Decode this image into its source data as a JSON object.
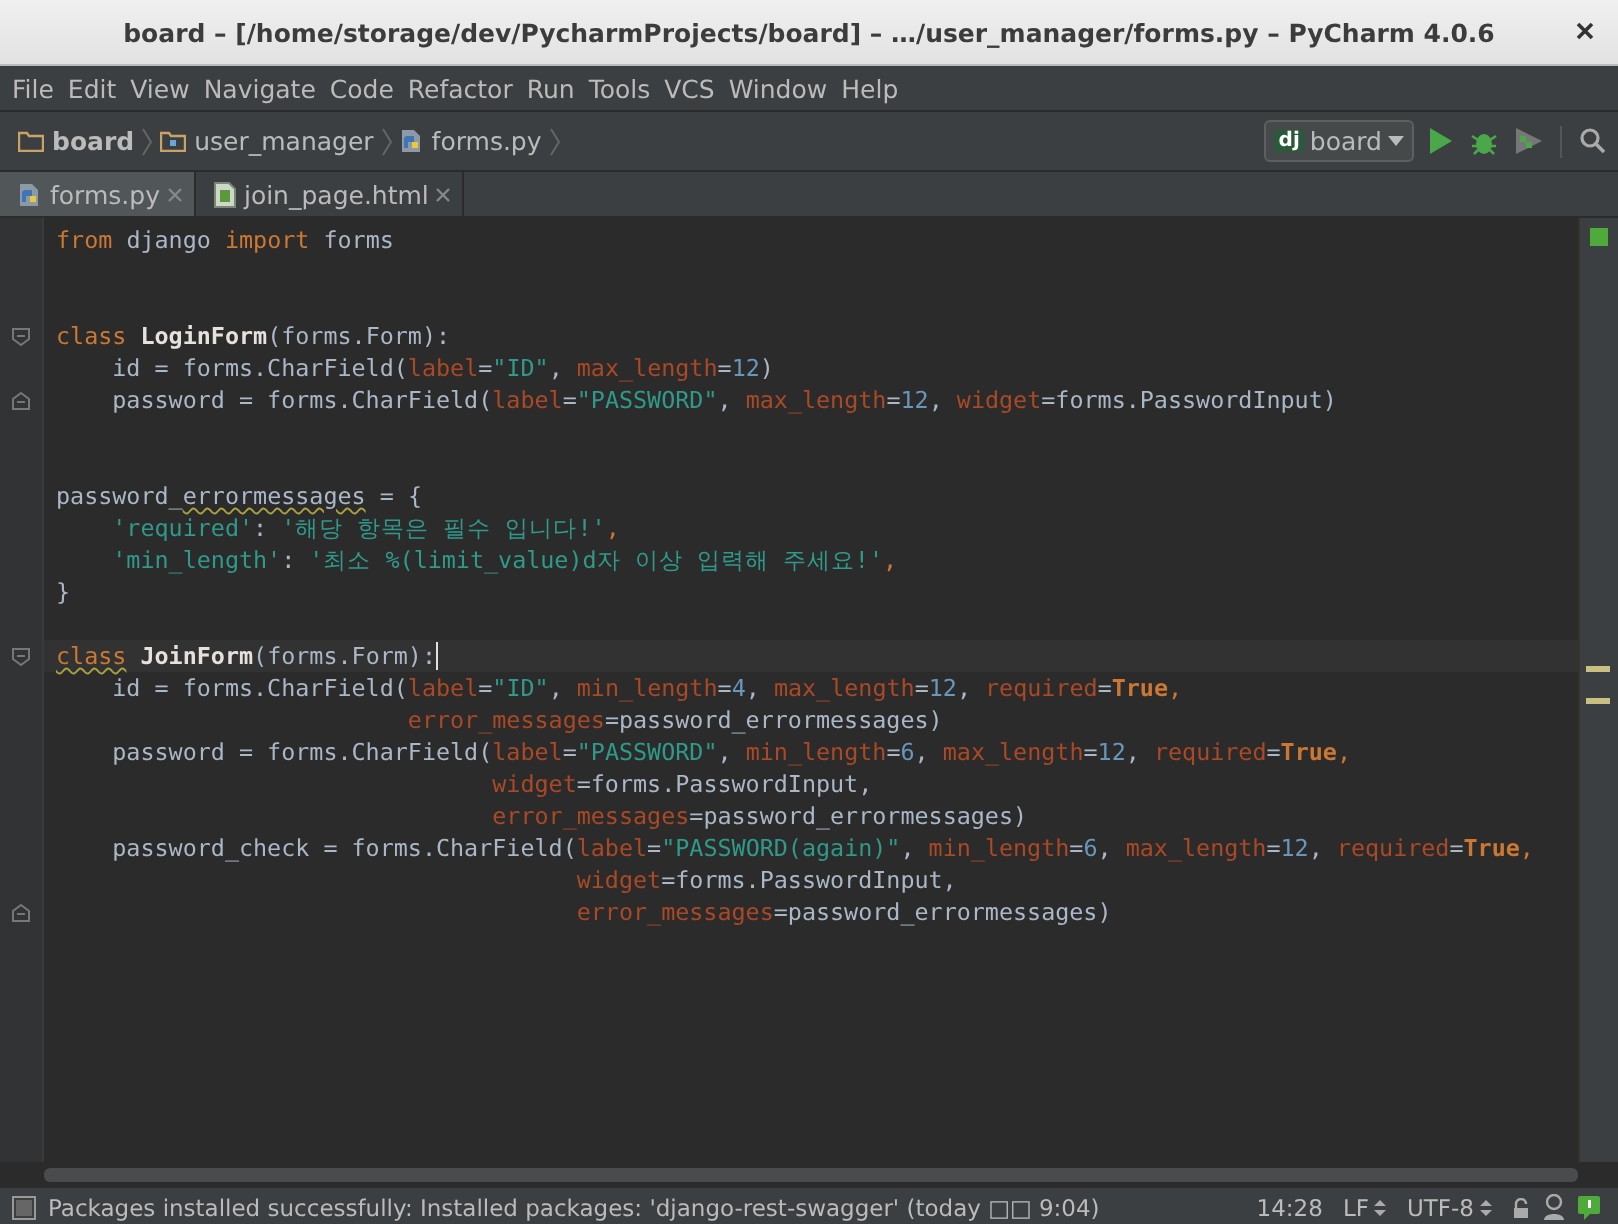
{
  "window": {
    "title": "board – [/home/storage/dev/PycharmProjects/board] – …/user_manager/forms.py – PyCharm 4.0.6"
  },
  "menu": [
    "File",
    "Edit",
    "View",
    "Navigate",
    "Code",
    "Refactor",
    "Run",
    "Tools",
    "VCS",
    "Window",
    "Help"
  ],
  "breadcrumbs": [
    {
      "label": "board",
      "kind": "project"
    },
    {
      "label": "user_manager",
      "kind": "package"
    },
    {
      "label": "forms.py",
      "kind": "python"
    }
  ],
  "run_config": {
    "label": "board",
    "badge": "dj"
  },
  "tabs": [
    {
      "label": "forms.py",
      "kind": "python",
      "selected": true
    },
    {
      "label": "join_page.html",
      "kind": "html",
      "selected": false
    }
  ],
  "lines": [
    {
      "kind": "code",
      "tokens": [
        {
          "kind": "kw",
          "t": "from"
        },
        {
          "kind": "p",
          "t": " django "
        },
        {
          "kind": "kw",
          "t": "import"
        },
        {
          "kind": "p",
          "t": " forms"
        }
      ]
    },
    {
      "kind": "blank"
    },
    {
      "kind": "blank"
    },
    {
      "kind": "code",
      "fold": {
        "kind": "start"
      },
      "tokens": [
        {
          "kind": "kw",
          "t": "class"
        },
        {
          "kind": "cls",
          "t": " LoginForm"
        },
        {
          "kind": "p",
          "t": "(forms.Form):"
        }
      ]
    },
    {
      "kind": "code",
      "tokens": [
        {
          "kind": "p",
          "t": "    id = forms.CharField("
        },
        {
          "kind": "prm",
          "t": "label"
        },
        {
          "kind": "p",
          "t": "="
        },
        {
          "kind": "str",
          "t": "\"ID\""
        },
        {
          "kind": "p",
          "t": ", "
        },
        {
          "kind": "prm",
          "t": "max_length"
        },
        {
          "kind": "p",
          "t": "="
        },
        {
          "kind": "num",
          "t": "12"
        },
        {
          "kind": "p",
          "t": ")"
        }
      ]
    },
    {
      "kind": "code",
      "fold": {
        "kind": "end"
      },
      "tokens": [
        {
          "kind": "p",
          "t": "    password = forms.CharField("
        },
        {
          "kind": "prm",
          "t": "label"
        },
        {
          "kind": "p",
          "t": "="
        },
        {
          "kind": "str",
          "t": "\"PASSWORD\""
        },
        {
          "kind": "p",
          "t": ", "
        },
        {
          "kind": "prm",
          "t": "max_length"
        },
        {
          "kind": "p",
          "t": "="
        },
        {
          "kind": "num",
          "t": "12"
        },
        {
          "kind": "p",
          "t": ", "
        },
        {
          "kind": "prm",
          "t": "widget"
        },
        {
          "kind": "p",
          "t": "=forms.PasswordInput)"
        }
      ]
    },
    {
      "kind": "blank"
    },
    {
      "kind": "blank"
    },
    {
      "kind": "code",
      "tokens": [
        {
          "kind": "p",
          "t": "password_"
        },
        {
          "kind": "p",
          "t": "errormessages",
          "warning": true
        },
        {
          "kind": "p",
          "t": " = {"
        }
      ]
    },
    {
      "kind": "code",
      "tokens": [
        {
          "kind": "str",
          "t": "    'required'"
        },
        {
          "kind": "p",
          "t": ": "
        },
        {
          "kind": "str",
          "t": "'해당 항목은 필수 입니다!'"
        },
        {
          "kind": "kw",
          "t": ","
        }
      ]
    },
    {
      "kind": "code",
      "tokens": [
        {
          "kind": "str",
          "t": "    'min_length'"
        },
        {
          "kind": "p",
          "t": ": "
        },
        {
          "kind": "str",
          "t": "'최소 %(limit_value)d자 이상 입력해 주세요!'"
        },
        {
          "kind": "kw",
          "t": ","
        }
      ]
    },
    {
      "kind": "code",
      "tokens": [
        {
          "kind": "p",
          "t": "}"
        }
      ]
    },
    {
      "kind": "blank"
    },
    {
      "kind": "code",
      "fold": {
        "kind": "start"
      },
      "current": true,
      "tokens": [
        {
          "kind": "kw",
          "t": "class",
          "warning": true
        },
        {
          "kind": "cls",
          "t": " JoinForm"
        },
        {
          "kind": "p",
          "t": "(forms.Form):"
        }
      ]
    },
    {
      "kind": "code",
      "tokens": [
        {
          "kind": "p",
          "t": "    id = forms.CharField("
        },
        {
          "kind": "prm",
          "t": "label"
        },
        {
          "kind": "p",
          "t": "="
        },
        {
          "kind": "str",
          "t": "\"ID\""
        },
        {
          "kind": "p",
          "t": ", "
        },
        {
          "kind": "prm",
          "t": "min_length"
        },
        {
          "kind": "p",
          "t": "="
        },
        {
          "kind": "num",
          "t": "4"
        },
        {
          "kind": "p",
          "t": ", "
        },
        {
          "kind": "prm",
          "t": "max_length"
        },
        {
          "kind": "p",
          "t": "="
        },
        {
          "kind": "num",
          "t": "12"
        },
        {
          "kind": "p",
          "t": ", "
        },
        {
          "kind": "prm",
          "t": "required"
        },
        {
          "kind": "p",
          "t": "="
        },
        {
          "kind": "bool",
          "t": "True"
        },
        {
          "kind": "kw",
          "t": ","
        }
      ]
    },
    {
      "kind": "code",
      "tokens": [
        {
          "kind": "prm",
          "t": "                         error_messages"
        },
        {
          "kind": "p",
          "t": "=password_errormessages)"
        }
      ]
    },
    {
      "kind": "code",
      "tokens": [
        {
          "kind": "p",
          "t": "    password = forms.CharField("
        },
        {
          "kind": "prm",
          "t": "label"
        },
        {
          "kind": "p",
          "t": "="
        },
        {
          "kind": "str",
          "t": "\"PASSWORD\""
        },
        {
          "kind": "p",
          "t": ", "
        },
        {
          "kind": "prm",
          "t": "min_length"
        },
        {
          "kind": "p",
          "t": "="
        },
        {
          "kind": "num",
          "t": "6"
        },
        {
          "kind": "p",
          "t": ", "
        },
        {
          "kind": "prm",
          "t": "max_length"
        },
        {
          "kind": "p",
          "t": "="
        },
        {
          "kind": "num",
          "t": "12"
        },
        {
          "kind": "p",
          "t": ", "
        },
        {
          "kind": "prm",
          "t": "required"
        },
        {
          "kind": "p",
          "t": "="
        },
        {
          "kind": "bool",
          "t": "True"
        },
        {
          "kind": "kw",
          "t": ","
        }
      ]
    },
    {
      "kind": "code",
      "tokens": [
        {
          "kind": "prm",
          "t": "                               widget"
        },
        {
          "kind": "p",
          "t": "=forms.PasswordInput,"
        }
      ]
    },
    {
      "kind": "code",
      "tokens": [
        {
          "kind": "prm",
          "t": "                               error_messages"
        },
        {
          "kind": "p",
          "t": "=password_errormessages)"
        }
      ]
    },
    {
      "kind": "code",
      "tokens": [
        {
          "kind": "p",
          "t": "    password_check = forms.CharField("
        },
        {
          "kind": "prm",
          "t": "label"
        },
        {
          "kind": "p",
          "t": "="
        },
        {
          "kind": "str",
          "t": "\"PASSWORD(again)\""
        },
        {
          "kind": "p",
          "t": ", "
        },
        {
          "kind": "prm",
          "t": "min_length"
        },
        {
          "kind": "p",
          "t": "="
        },
        {
          "kind": "num",
          "t": "6"
        },
        {
          "kind": "p",
          "t": ", "
        },
        {
          "kind": "prm",
          "t": "max_length"
        },
        {
          "kind": "p",
          "t": "="
        },
        {
          "kind": "num",
          "t": "12"
        },
        {
          "kind": "p",
          "t": ", "
        },
        {
          "kind": "prm",
          "t": "required"
        },
        {
          "kind": "p",
          "t": "="
        },
        {
          "kind": "bool",
          "t": "True"
        },
        {
          "kind": "kw",
          "t": ","
        }
      ]
    },
    {
      "kind": "code",
      "tokens": [
        {
          "kind": "prm",
          "t": "                                     widget"
        },
        {
          "kind": "p",
          "t": "=forms.PasswordInput,"
        }
      ]
    },
    {
      "kind": "code",
      "fold": {
        "kind": "end"
      },
      "tokens": [
        {
          "kind": "prm",
          "t": "                                     error_messages"
        },
        {
          "kind": "p",
          "t": "=password_errormessages)"
        }
      ]
    }
  ],
  "status_bar": {
    "message": "Packages installed successfully: Installed packages: 'django-rest-swagger' (today □□ 9:04)",
    "position": "14:28",
    "line_separator": "LF",
    "encoding": "UTF-8"
  }
}
